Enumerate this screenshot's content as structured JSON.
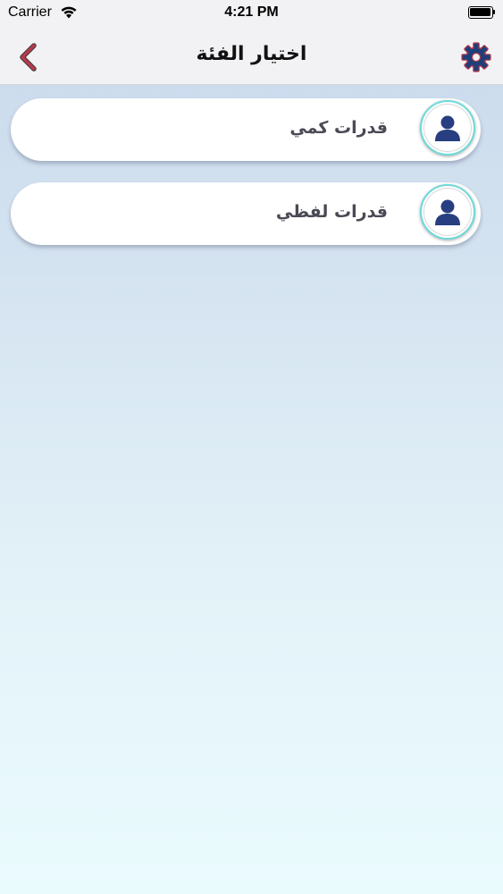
{
  "status_bar": {
    "carrier": "Carrier",
    "time": "4:21 PM",
    "icons": [
      "wifi-icon",
      "battery-icon"
    ]
  },
  "nav": {
    "title": "اختيار الفئة",
    "back_icon": "chevron-left-icon",
    "settings_icon": "gear-icon",
    "accent_color": "#b83a4b",
    "settings_color": "#1e3f7a"
  },
  "categories": [
    {
      "label": "قدرات كمي",
      "icon": "user-avatar-icon"
    },
    {
      "label": "قدرات لفظي",
      "icon": "user-avatar-icon"
    }
  ],
  "colors": {
    "avatar_ring": "#6ddada",
    "avatar_icon": "#273e80",
    "label": "#4a4a56"
  }
}
